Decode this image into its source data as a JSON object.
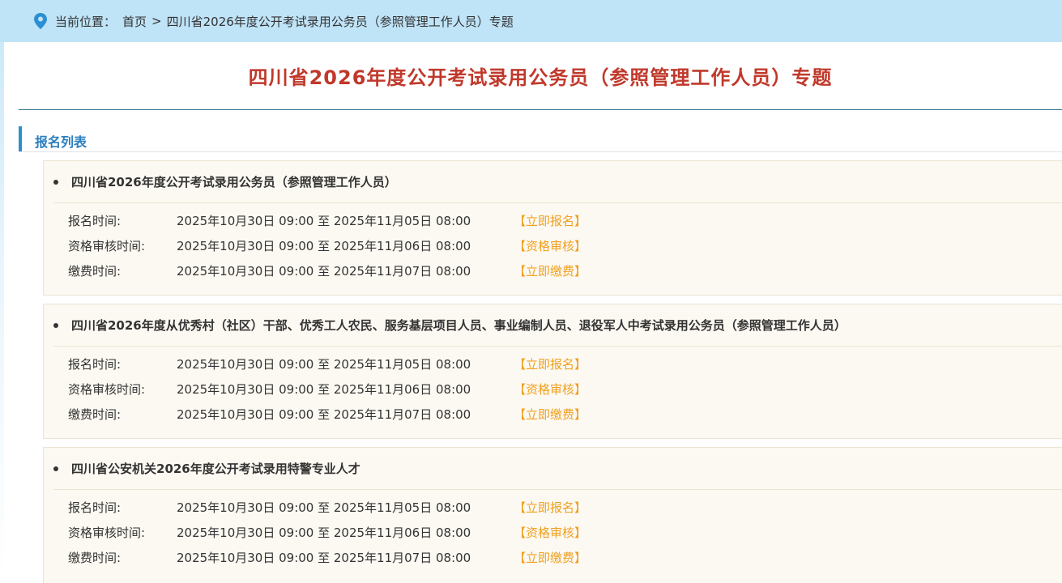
{
  "breadcrumb": {
    "label": "当前位置：",
    "home": "首页",
    "separator": ">",
    "current": "四川省2026年度公开考试录用公务员（参照管理工作人员）专题"
  },
  "page_title": "四川省2026年度公开考试录用公务员（参照管理工作人员）专题",
  "section_title": "报名列表",
  "colors": {
    "title": "#c0392b",
    "accent": "#2b8fd1",
    "action": "#f0a020",
    "bar": "#bfe3f7"
  },
  "cards": [
    {
      "title": "四川省2026年度公开考试录用公务员（参照管理工作人员）",
      "rows": [
        {
          "label": "报名时间:",
          "time": "2025年10月30日 09:00 至 2025年11月05日 08:00",
          "action": "【立即报名】"
        },
        {
          "label": "资格审核时间:",
          "time": "2025年10月30日 09:00 至 2025年11月06日 08:00",
          "action": "【资格审核】"
        },
        {
          "label": "缴费时间:",
          "time": "2025年10月30日 09:00 至 2025年11月07日 08:00",
          "action": "【立即缴费】"
        }
      ]
    },
    {
      "title": "四川省2026年度从优秀村（社区）干部、优秀工人农民、服务基层项目人员、事业编制人员、退役军人中考试录用公务员（参照管理工作人员）",
      "rows": [
        {
          "label": "报名时间:",
          "time": "2025年10月30日 09:00 至 2025年11月05日 08:00",
          "action": "【立即报名】"
        },
        {
          "label": "资格审核时间:",
          "time": "2025年10月30日 09:00 至 2025年11月06日 08:00",
          "action": "【资格审核】"
        },
        {
          "label": "缴费时间:",
          "time": "2025年10月30日 09:00 至 2025年11月07日 08:00",
          "action": "【立即缴费】"
        }
      ]
    },
    {
      "title": "四川省公安机关2026年度公开考试录用特警专业人才",
      "rows": [
        {
          "label": "报名时间:",
          "time": "2025年10月30日 09:00 至 2025年11月05日 08:00",
          "action": "【立即报名】"
        },
        {
          "label": "资格审核时间:",
          "time": "2025年10月30日 09:00 至 2025年11月06日 08:00",
          "action": "【资格审核】"
        },
        {
          "label": "缴费时间:",
          "time": "2025年10月30日 09:00 至 2025年11月07日 08:00",
          "action": "【立即缴费】"
        }
      ]
    }
  ]
}
